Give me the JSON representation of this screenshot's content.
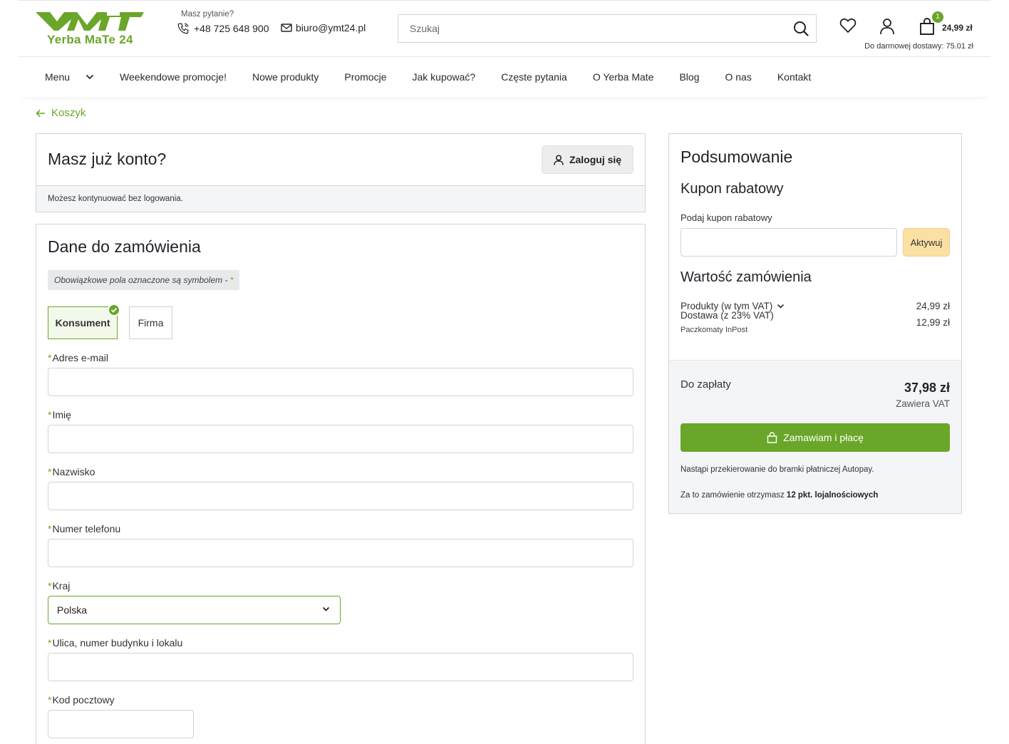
{
  "header": {
    "logo_text": "Yerba MaTe 24",
    "contact_question": "Masz pytanie?",
    "phone": "+48 725 648 900",
    "email": "biuro@ymt24.pl",
    "search_placeholder": "Szukaj",
    "cart_count": "1",
    "cart_total": "24,99 zł",
    "free_delivery": "Do darmowej dostawy: 75.01 zł"
  },
  "nav": {
    "items": [
      "Menu",
      "Weekendowe promocje!",
      "Nowe produkty",
      "Promocje",
      "Jak kupować?",
      "Częste pytania",
      "O Yerba Mate",
      "Blog",
      "O nas",
      "Kontakt"
    ]
  },
  "breadcrumb": {
    "back_label": "Koszyk"
  },
  "login": {
    "title": "Masz już konto?",
    "button": "Zaloguj się",
    "note": "Możesz kontynuować bez logowania."
  },
  "order": {
    "title": "Dane do zamówienia",
    "required_note": "Obowiązkowe pola oznaczone są symbolem -",
    "required_star": "*",
    "type_consumer": "Konsument",
    "type_company": "Firma",
    "fields": {
      "email": "Adres e-mail",
      "first_name": "Imię",
      "last_name": "Nazwisko",
      "phone": "Numer telefonu",
      "country": "Kraj",
      "street": "Ulica, numer budynku i lokalu",
      "postal": "Kod pocztowy"
    },
    "country_value": "Polska"
  },
  "summary": {
    "title": "Podsumowanie",
    "coupon_title": "Kupon rabatowy",
    "coupon_label": "Podaj kupon rabatowy",
    "coupon_button": "Aktywuj",
    "value_title": "Wartość zamówienia",
    "products_label": "Produkty (w tym VAT)",
    "products_value": "24,99 zł",
    "delivery_label": "Dostawa (z 23% VAT)",
    "delivery_value": "12,99 zł",
    "delivery_method": "Paczkomaty InPost",
    "to_pay_label": "Do zapłaty",
    "to_pay_value": "37,98 zł",
    "vat_note": "Zawiera VAT",
    "order_button": "Zamawiam i płacę",
    "redirect_note": "Nastąpi przekierowanie do bramki płatniczej Autopay.",
    "loyalty_prefix": "Za to zamówienie otrzymasz",
    "loyalty_points": "12 pkt. lojalnościowych"
  },
  "colors": {
    "accent": "#6aa629",
    "coupon_button": "#fbe0a4"
  }
}
